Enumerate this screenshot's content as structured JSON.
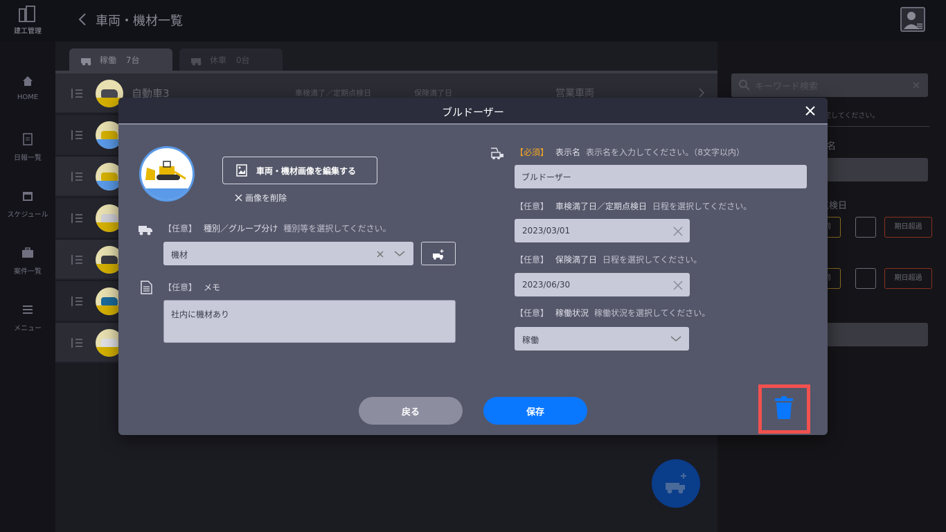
{
  "app": {
    "logo_text": "建工管理",
    "page_title": "車両・機材一覧"
  },
  "nav": {
    "items": [
      {
        "label": "HOME"
      },
      {
        "label": "日報一覧"
      },
      {
        "label": "スケジュール"
      },
      {
        "label": "案件一覧"
      },
      {
        "label": "メニュー"
      }
    ]
  },
  "tabs": {
    "active_label": "稼働",
    "active_count": "7台",
    "inactive_label": "休車",
    "inactive_count": "0台"
  },
  "list": {
    "first_row": {
      "name": "自動車3",
      "col_inspection": "車検満了／定期点検日",
      "col_insurance": "保険満了日",
      "type": "営業車両"
    },
    "row_count": 7
  },
  "right_panel": {
    "search_placeholder": "キーワード検索",
    "note": "設定してください。",
    "label_name": "名",
    "label_inspection": "点検日",
    "btn_before": "前",
    "btn_overdue": "期日超過",
    "btn_before2": "前",
    "btn_overdue2": "期日超過"
  },
  "modal": {
    "title": "ブルドーザー",
    "edit_image_button": "車両・機材画像を編集する",
    "delete_image": "画像を削除",
    "optional_tag": "【任意】",
    "required_tag": "【必須】",
    "type_field": {
      "name": "種別／グループ分け",
      "hint": "種別等を選択してください。",
      "value": "機材"
    },
    "memo_field": {
      "name": "メモ",
      "value": "社内に機材あり"
    },
    "display_name_field": {
      "name": "表示名",
      "hint": "表示名を入力してください。（8文字以内）",
      "value": "ブルドーザー"
    },
    "inspection_field": {
      "name": "車検満了日／定期点検日",
      "hint": "日程を選択してください。",
      "value": "2023/03/01"
    },
    "insurance_field": {
      "name": "保険満了日",
      "hint": "日程を選択してください。",
      "value": "2023/06/30"
    },
    "status_field": {
      "name": "稼働状況",
      "hint": "稼働状況を選択してください。",
      "value": "稼働"
    },
    "back_button": "戻る",
    "save_button": "保存"
  },
  "colors": {
    "modal_bg": "#545769",
    "header_bg": "#2b2d3c",
    "accent_blue": "#0a77ff",
    "required_orange": "#f5a623",
    "highlight_red": "#f2514f"
  }
}
